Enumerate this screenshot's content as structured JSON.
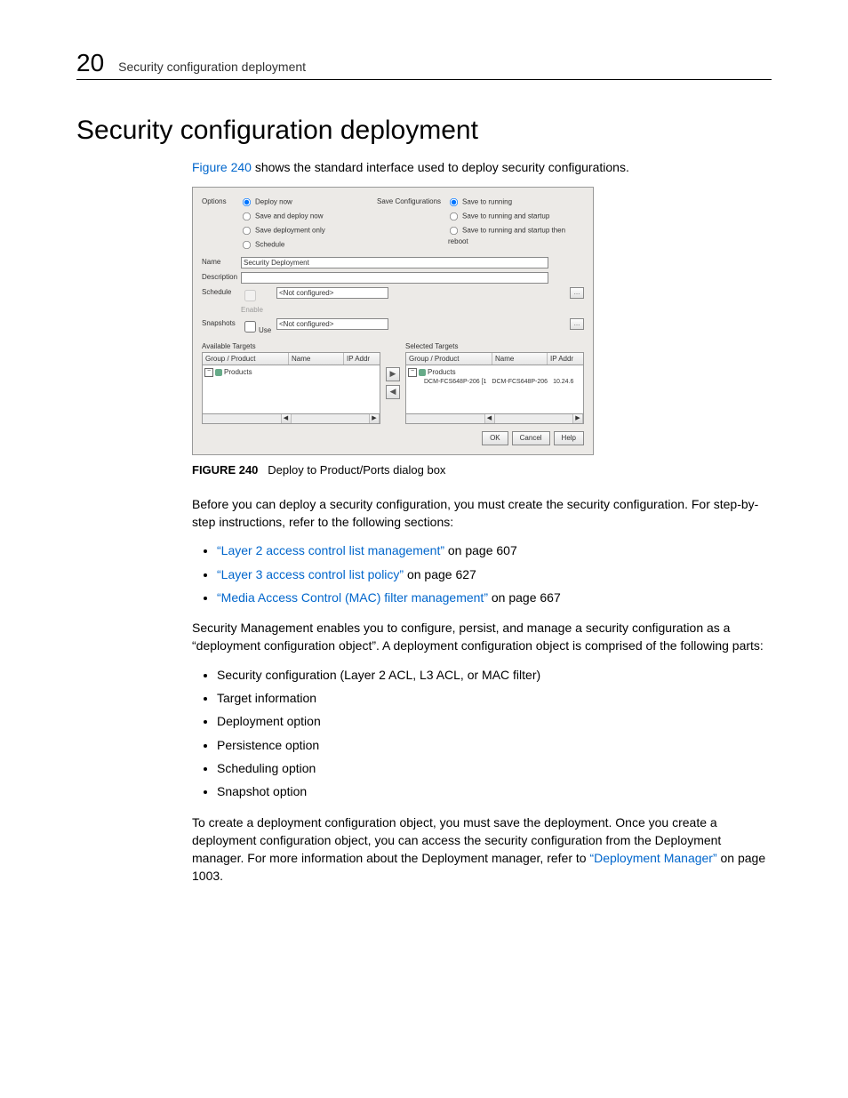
{
  "header": {
    "chapter_number": "20",
    "chapter_title": "Security configuration deployment"
  },
  "section_title": "Security configuration deployment",
  "intro": {
    "link_text": "Figure 240",
    "rest": " shows the standard interface used to deploy security configurations."
  },
  "dialog": {
    "options_label": "Options",
    "options": {
      "deploy_now": "Deploy now",
      "save_deploy_now": "Save and deploy now",
      "save_only": "Save deployment only",
      "schedule": "Schedule"
    },
    "save_config_label": "Save Configurations",
    "save_config": {
      "running": "Save to running",
      "running_startup": "Save to running and startup",
      "running_startup_reboot": "Save to running and startup then reboot"
    },
    "name_label": "Name",
    "name_value": "Security Deployment",
    "description_label": "Description",
    "schedule_label": "Schedule",
    "schedule_chk": "Enable",
    "not_configured": "<Not configured>",
    "snapshots_label": "Snapshots",
    "snapshots_chk": "Use",
    "ellipsis": "…",
    "available_targets": "Available Targets",
    "selected_targets": "Selected Targets",
    "col_group": "Group / Product",
    "col_name": "Name",
    "col_ip": "IP Addr",
    "products_node": "Products",
    "selected_item_name": "DCM-FCS648P-206 [1",
    "selected_item_name2": "DCM-FCS648P-206",
    "selected_item_ip": "10.24.6",
    "arrow_right": "▶",
    "arrow_left": "◀",
    "scroll_left": "◀",
    "scroll_right": "▶",
    "ok": "OK",
    "cancel": "Cancel",
    "help": "Help"
  },
  "figure": {
    "label": "FIGURE 240",
    "caption": "Deploy to Product/Ports dialog box"
  },
  "para_before_links": "Before you can deploy a security configuration, you must create the security configuration. For step-by-step instructions, refer to the following sections:",
  "link_bullets": [
    {
      "link": "“Layer 2 access control list management”",
      "tail": " on page 607"
    },
    {
      "link": "“Layer 3 access control list policy”",
      "tail": " on page 627"
    },
    {
      "link": "“Media Access Control (MAC) filter management”",
      "tail": " on page 667"
    }
  ],
  "para_mgmt": "Security Management enables you to configure, persist, and manage a security configuration as a “deployment configuration object”. A deployment configuration object is comprised of the following parts:",
  "plain_bullets": [
    "Security configuration (Layer 2 ACL, L3 ACL, or MAC filter)",
    "Target information",
    "Deployment option",
    "Persistence option",
    "Scheduling option",
    "Snapshot option"
  ],
  "para_last_pre": "To create a deployment configuration object, you must save the deployment. Once you create a deployment configuration object, you can access the security configuration from the Deployment manager. For more information about the Deployment manager, refer to ",
  "para_last_link": "“Deployment Manager”",
  "para_last_post": " on page 1003."
}
